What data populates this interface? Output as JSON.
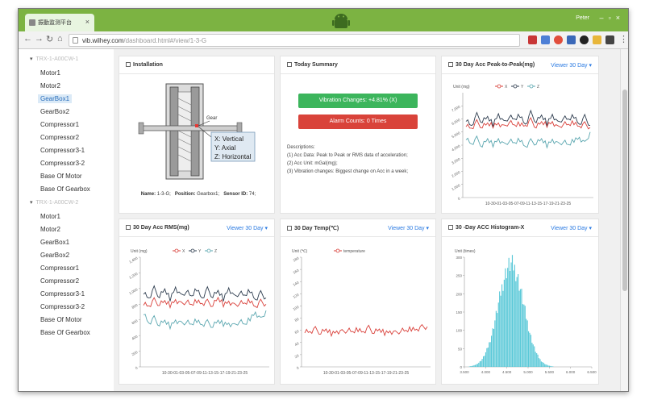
{
  "browser": {
    "tab_title": "振動监测平台",
    "url_host": "vib.wilhey.com",
    "url_path": "/dashboard.html#/view/1-3-G",
    "user": "Peter"
  },
  "sidebar": {
    "groups": [
      {
        "label": "TRX-1-A00CW-1",
        "items": [
          "Motor1",
          "Motor2",
          "GearBox1",
          "GearBox2",
          "Compressor1",
          "Compressor2",
          "Compressor3-1",
          "Compressor3-2",
          "Base Of Motor",
          "Base Of Gearbox"
        ]
      },
      {
        "label": "TRX-1-A00CW-2",
        "items": [
          "Motor1",
          "Motor2",
          "GearBox1",
          "GearBox2",
          "Compressor1",
          "Compressor2",
          "Compressor3-1",
          "Compressor3-2",
          "Base Of Motor",
          "Base Of Gearbox"
        ]
      }
    ],
    "active_item": "GearBox1"
  },
  "installation": {
    "title": "Installation",
    "gear_label": "Gear",
    "axis_x": "X: Vertical",
    "axis_y": "Y: Axial",
    "axis_z": "Z: Horizontal",
    "name_label": "Name:",
    "name_value": "1-3-G;",
    "position_label": "Position:",
    "position_value": "Gearbox1;",
    "sensor_label": "Sensor ID:",
    "sensor_value": "74;"
  },
  "summary": {
    "title": "Today Summary",
    "vibration_btn": "Vibration Changes: +4.81% (X)",
    "alarm_btn": "Alarm Counts: 0 Times",
    "desc_title": "Descriptions:",
    "desc_lines": [
      "(1) Acc Data: Peak to Peak or RMS data of acceleration;",
      "(2) Acc Unit: mGal(mg);",
      "(3) Vibration changes: Biggest change on Acc in a week;"
    ]
  },
  "viewer_label": "Viewer 30 Day",
  "colors": {
    "x": "#d9403a",
    "y": "#2e3d4f",
    "z": "#5ba7b0",
    "temperature": "#d9403a",
    "histogram": "#5bc9d8",
    "green": "#3cb55c",
    "red": "#d9433a",
    "accent": "#7cb342"
  },
  "chart_data": [
    {
      "type": "line",
      "title": "30 Day Acc Peak-to-Peak(mg)",
      "ylabel": "Unit (mg)",
      "ylim": [
        0,
        8000
      ],
      "yticks": [
        "0",
        "1,000",
        "2,000",
        "3,000",
        "4,000",
        "5,000",
        "6,000",
        "7,000"
      ],
      "xlabel_ticks": "10-30-01-03-05-07-09-11-13-15-17-19-21-23-25",
      "legend": [
        "X",
        "Y",
        "Z"
      ],
      "series": [
        {
          "name": "X",
          "values": [
            5600,
            5300,
            5750,
            5400,
            5600,
            5500,
            5700,
            5350,
            5800,
            5450,
            5650,
            5500,
            5900,
            5400,
            5700,
            5550,
            5800,
            5300,
            5650,
            5500,
            5750,
            5450,
            5600,
            5350
          ]
        },
        {
          "name": "Y",
          "values": [
            6000,
            5500,
            6300,
            5800,
            6100,
            5600,
            6400,
            5700,
            6200,
            5900,
            6300,
            5600,
            6450,
            5800,
            6200,
            5700,
            6350,
            5650,
            6100,
            5900,
            6250,
            5600,
            6150,
            5500
          ]
        },
        {
          "name": "Z",
          "values": [
            4600,
            4100,
            4500,
            3950,
            4400,
            4050,
            4500,
            4000,
            4350,
            4100,
            4450,
            3900,
            4300,
            4150,
            4400,
            4000,
            4450,
            4050,
            4300,
            3950,
            4400,
            4600,
            4100,
            5000
          ]
        }
      ]
    },
    {
      "type": "line",
      "title": "30 Day Acc RMS(mg)",
      "ylabel": "Unit (mg)",
      "ylim": [
        0,
        1400
      ],
      "yticks": [
        "0",
        "200",
        "400",
        "600",
        "800",
        "1,000",
        "1,200",
        "1,400"
      ],
      "xlabel_ticks": "10-30-01-03-05-07-09-11-13-15-17-19-21-23-25",
      "legend": [
        "X",
        "Y",
        "Z"
      ],
      "series": [
        {
          "name": "X",
          "values": [
            820,
            780,
            850,
            800,
            830,
            790,
            860,
            800,
            840,
            780,
            850,
            810,
            830,
            790,
            870,
            800,
            840,
            780,
            820,
            800,
            850,
            770,
            830,
            800
          ]
        },
        {
          "name": "Y",
          "values": [
            960,
            880,
            1000,
            900,
            980,
            870,
            1020,
            900,
            970,
            890,
            1000,
            880,
            990,
            900,
            960,
            870,
            1010,
            890,
            950,
            900,
            980,
            860,
            940,
            880
          ]
        },
        {
          "name": "Z",
          "values": [
            700,
            560,
            620,
            540,
            580,
            520,
            600,
            550,
            580,
            530,
            600,
            540,
            570,
            520,
            580,
            550,
            560,
            520,
            590,
            530,
            620,
            700,
            600,
            720
          ]
        }
      ]
    },
    {
      "type": "line",
      "title": "30 Day Temp(℃)",
      "ylabel": "Unit (℃)",
      "ylim": [
        0,
        180
      ],
      "yticks": [
        "0",
        "20",
        "40",
        "60",
        "80",
        "100",
        "120",
        "140",
        "160",
        "180"
      ],
      "xlabel_ticks": "10-30-01-03-05-07-09-11-13-15-17-19-21-23-25",
      "legend": [
        "temperature"
      ],
      "series": [
        {
          "name": "temperature",
          "values": [
            60,
            58,
            62,
            56,
            60,
            55,
            59,
            57,
            61,
            56,
            62,
            58,
            64,
            57,
            60,
            56,
            59,
            55,
            60,
            58,
            63,
            62,
            65,
            66
          ]
        }
      ]
    },
    {
      "type": "bar",
      "title": "30 -Day ACC Histogram-X",
      "ylabel": "Unit (times)",
      "ylim": [
        0,
        300
      ],
      "yticks": [
        "0",
        "50",
        "100",
        "150",
        "200",
        "250",
        "300"
      ],
      "xticks": [
        "3.500",
        "4.000",
        "4.500",
        "5.000",
        "5.500",
        "6.000",
        "6.500"
      ],
      "xlim": [
        3.5,
        6.5
      ],
      "mean": 4.6,
      "std": 0.3,
      "peak": 280
    }
  ]
}
